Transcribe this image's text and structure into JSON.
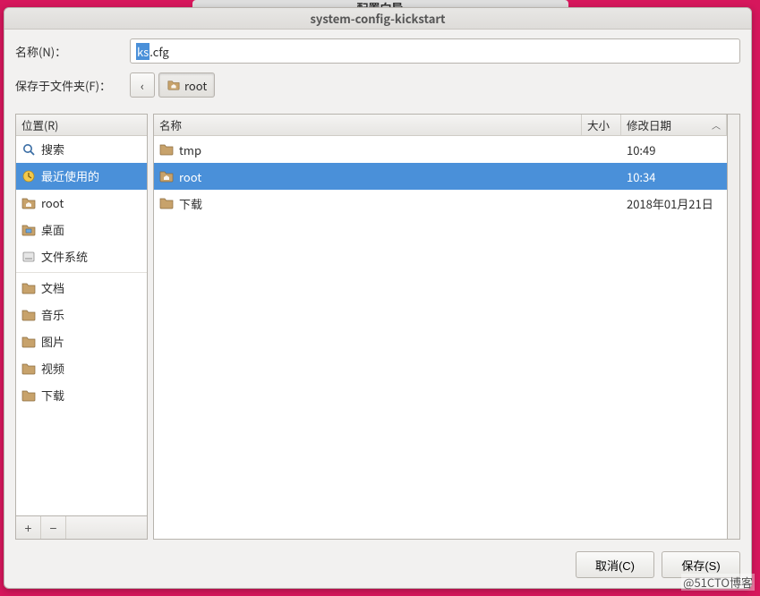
{
  "behind_window_title": "配置向导",
  "dialog": {
    "title": "system-config-kickstart"
  },
  "name_row": {
    "label": "名称(N)：",
    "value_selected": "ks",
    "value_rest": ".cfg"
  },
  "folder_row": {
    "label": "保存于文件夹(F)：",
    "back_label": "‹",
    "current_folder": "root"
  },
  "places": {
    "header": "位置(R)",
    "items": [
      {
        "icon": "search",
        "label": "搜索",
        "selected": false
      },
      {
        "icon": "recent",
        "label": "最近使用的",
        "selected": true
      },
      {
        "icon": "home",
        "label": "root",
        "selected": false
      },
      {
        "icon": "desktop",
        "label": "桌面",
        "selected": false
      },
      {
        "icon": "drive",
        "label": "文件系统",
        "selected": false
      },
      {
        "icon": "folder",
        "label": "文档",
        "selected": false
      },
      {
        "icon": "folder",
        "label": "音乐",
        "selected": false
      },
      {
        "icon": "folder",
        "label": "图片",
        "selected": false
      },
      {
        "icon": "folder",
        "label": "视频",
        "selected": false
      },
      {
        "icon": "folder",
        "label": "下载",
        "selected": false
      }
    ],
    "add_label": "+",
    "remove_label": "−"
  },
  "columns": {
    "name": "名称",
    "size": "大小",
    "date": "修改日期"
  },
  "files": [
    {
      "icon": "folder",
      "name": "tmp",
      "size": "",
      "date": "10:49",
      "selected": false
    },
    {
      "icon": "home",
      "name": "root",
      "size": "",
      "date": "10:34",
      "selected": true
    },
    {
      "icon": "folder",
      "name": "下载",
      "size": "",
      "date": "2018年01月21日",
      "selected": false
    }
  ],
  "footer": {
    "cancel": "取消(C)",
    "save": "保存(S)"
  },
  "watermark": "@51CTO博客"
}
